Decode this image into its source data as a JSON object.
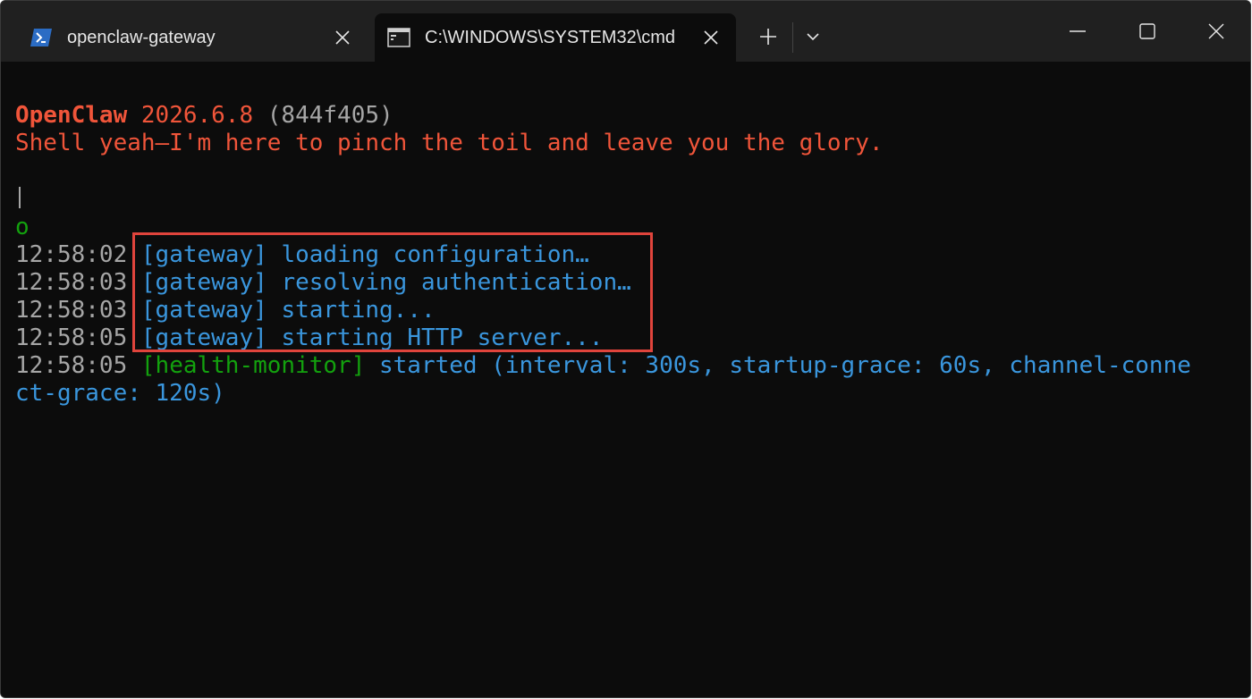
{
  "tabs": [
    {
      "title": "openclaw-gateway",
      "icon": "powershell-icon",
      "active": false
    },
    {
      "title": "C:\\WINDOWS\\SYSTEM32\\cmd",
      "icon": "cmd-icon",
      "active": true
    }
  ],
  "titlebar": {
    "new_tab_icon": "plus-icon",
    "dropdown_icon": "chevron-down-icon",
    "window_controls": [
      "minimize-icon",
      "maximize-icon",
      "close-icon"
    ]
  },
  "colors": {
    "accent_orange": "#f0553a",
    "log_blue": "#3a96dd",
    "log_green": "#13a10e",
    "timestamp_gray": "#a6a6a6",
    "highlight_red": "#e0443c",
    "background": "#0c0c0c"
  },
  "terminal": {
    "banner": {
      "name": "OpenClaw",
      "version": "2026.6.8",
      "commit": "(844f405)",
      "tagline": "Shell yeah—I'm here to pinch the toil and leave you the glory."
    },
    "spinner_char": "o",
    "logs": [
      {
        "time": "12:58:02",
        "tag": "[gateway]",
        "message": "loading configuration…"
      },
      {
        "time": "12:58:03",
        "tag": "[gateway]",
        "message": "resolving authentication…"
      },
      {
        "time": "12:58:03",
        "tag": "[gateway]",
        "message": "starting..."
      },
      {
        "time": "12:58:05",
        "tag": "[gateway]",
        "message": "starting HTTP server..."
      },
      {
        "time": "12:58:05",
        "tag": "[health-monitor]",
        "message": "started (interval: 300s, startup-grace: 60s, channel-conne",
        "message_cont": "ct-grace: 120s)"
      }
    ]
  }
}
